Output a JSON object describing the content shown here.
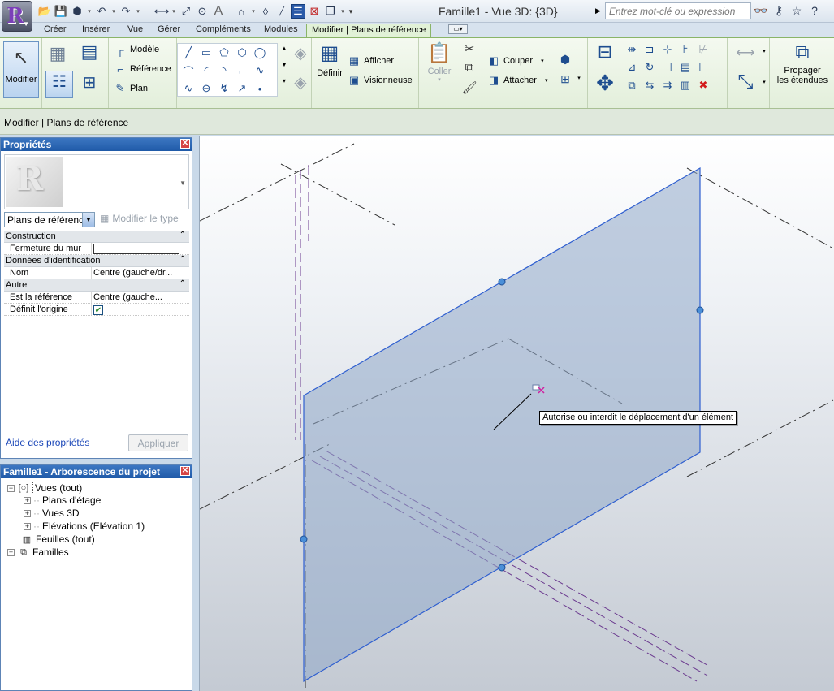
{
  "title_bar": {
    "app_icon_letter": "R",
    "window_title": "Famille1 - Vue 3D: {3D}",
    "search_placeholder": "Entrez mot-clé ou expression"
  },
  "tabs": [
    {
      "label": "Créer"
    },
    {
      "label": "Insérer"
    },
    {
      "label": "Vue"
    },
    {
      "label": "Gérer"
    },
    {
      "label": "Compléments"
    },
    {
      "label": "Modules"
    },
    {
      "label": "Modifier | Plans de référence",
      "active": true
    }
  ],
  "ribbon": {
    "modify_label": "Modifier",
    "model_label": "Modèle",
    "reference_label": "Référence",
    "plan_label": "Plan",
    "define_label": "Définir",
    "show_label": "Afficher",
    "viewer_label": "Visionneuse",
    "paste_label": "Coller",
    "cut_label": "Couper",
    "attach_label": "Attacher",
    "propagate_label_1": "Propager",
    "propagate_label_2": "les étendues"
  },
  "options_bar": {
    "context_label": "Modifier | Plans de référence"
  },
  "properties": {
    "title": "Propriétés",
    "type_selector": "Plans de référenc",
    "edit_type_label": "Modifier le type",
    "groups": {
      "construction": "Construction",
      "identity": "Données d'identification",
      "other": "Autre"
    },
    "rows": {
      "wall_closure_name": "Fermeture du mur",
      "name_name": "Nom",
      "name_value": "Centre (gauche/dr...",
      "is_reference_name": "Est la référence",
      "is_reference_value": "Centre (gauche...",
      "defines_origin_name": "Définit l'origine",
      "defines_origin_checked": true
    },
    "help_link": "Aide des propriétés",
    "apply_button": "Appliquer"
  },
  "project_browser": {
    "title": "Famille1 - Arborescence du projet",
    "nodes": {
      "views_all": "Vues (tout)",
      "floor_plans": "Plans d'étage",
      "views_3d": "Vues 3D",
      "elevations": "Elévations (Elévation 1)",
      "sheets": "Feuilles (tout)",
      "families": "Familles"
    }
  },
  "viewport": {
    "tooltip": "Autorise ou interdit le déplacement d'un élément",
    "plane_fill": "#8fa8c8",
    "plane_edge": "#2f5fd0"
  }
}
